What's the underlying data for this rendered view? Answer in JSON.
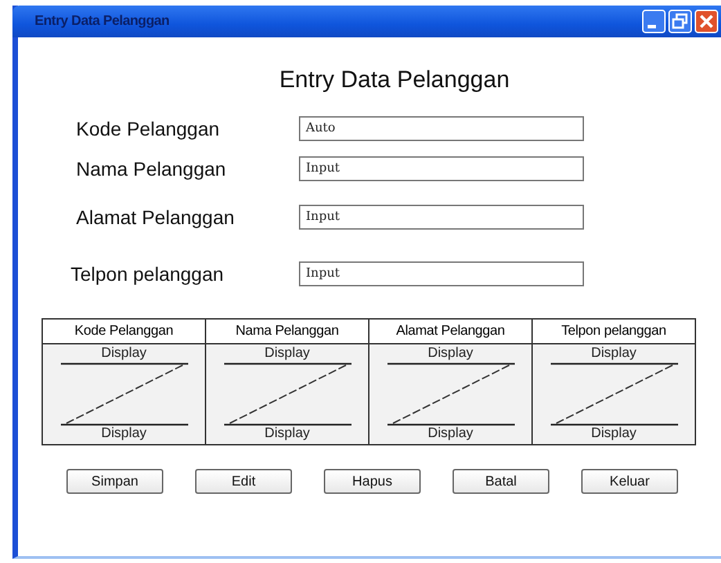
{
  "window": {
    "title": "Entry Data Pelanggan"
  },
  "heading": "Entry Data Pelanggan",
  "fields": [
    {
      "label": "Kode Pelanggan",
      "value": "Auto"
    },
    {
      "label": "Nama Pelanggan",
      "value": "Input"
    },
    {
      "label": "Alamat Pelanggan",
      "value": "Input"
    },
    {
      "label": "Telpon pelanggan",
      "value": "Input"
    }
  ],
  "table": {
    "columns": [
      {
        "heading": "Kode Pelanggan",
        "top": "Display",
        "bottom": "Display"
      },
      {
        "heading": "Nama Pelanggan",
        "top": "Display",
        "bottom": "Display"
      },
      {
        "heading": "Alamat Pelanggan",
        "top": "Display",
        "bottom": "Display"
      },
      {
        "heading": "Telpon pelanggan",
        "top": "Display",
        "bottom": "Display"
      }
    ]
  },
  "buttons": [
    "Simpan",
    "Edit",
    "Hapus",
    "Batal",
    "Keluar"
  ]
}
